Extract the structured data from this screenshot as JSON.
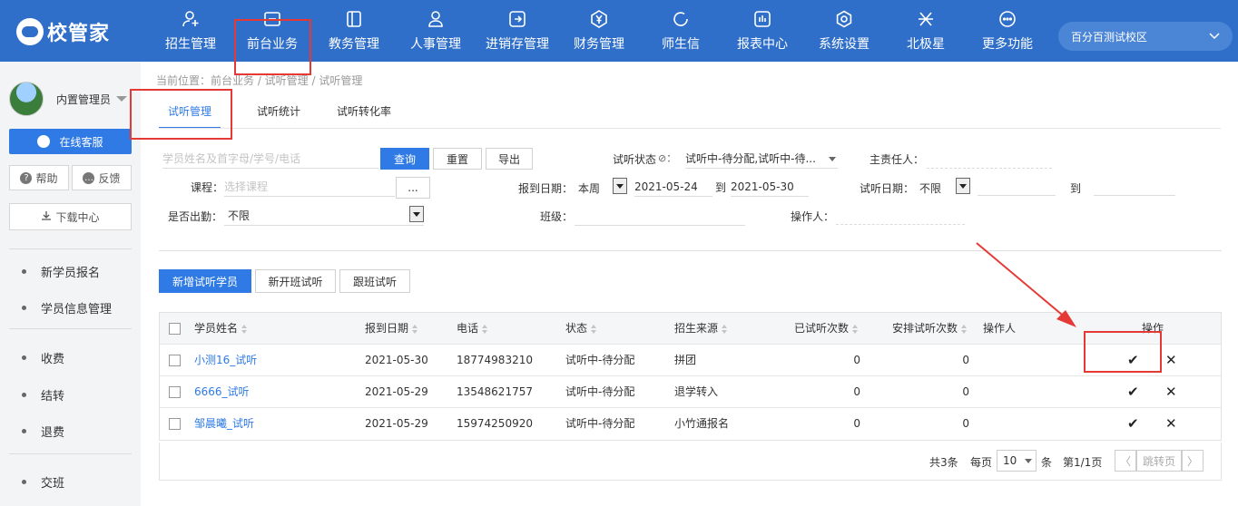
{
  "app": {
    "logo_text": "校管家",
    "campus": "百分百测试校区"
  },
  "nav": [
    {
      "label": "招生管理",
      "icon": "user-add-icon"
    },
    {
      "label": "前台业务",
      "icon": "desk-icon"
    },
    {
      "label": "教务管理",
      "icon": "book-icon"
    },
    {
      "label": "人事管理",
      "icon": "person-icon"
    },
    {
      "label": "进销存管理",
      "icon": "inventory-icon"
    },
    {
      "label": "财务管理",
      "icon": "yen-icon"
    },
    {
      "label": "师生信",
      "icon": "chat-icon"
    },
    {
      "label": "报表中心",
      "icon": "report-icon"
    },
    {
      "label": "系统设置",
      "icon": "settings-icon"
    },
    {
      "label": "北极星",
      "icon": "star-icon"
    },
    {
      "label": "更多功能",
      "icon": "more-icon"
    }
  ],
  "sidebar": {
    "user_name": "内置管理员",
    "customer_service": "在线客服",
    "help": "帮助",
    "feedback": "反馈",
    "download": "下载中心",
    "menu": [
      "新学员报名",
      "学员信息管理",
      "收费",
      "结转",
      "退费",
      "交班"
    ]
  },
  "breadcrumb": "当前位置：前台业务 / 试听管理 / 试听管理",
  "tabs": [
    "试听管理",
    "试听统计",
    "试听转化率"
  ],
  "filters": {
    "search_placeholder": "学员姓名及首字母/学号/电话",
    "query_btn": "查询",
    "reset_btn": "重置",
    "export_btn": "导出",
    "status_label": "试听状态",
    "status_value": "试听中-待分配,试听中-待...",
    "owner_label": "主责任人：",
    "course_label": "课程：",
    "course_placeholder": "选择课程",
    "more_btn": "...",
    "report_date_label": "报到日期：",
    "report_date_mode": "本周",
    "date_from": "2021-05-24",
    "to_text": "到",
    "date_to": "2021-05-30",
    "trial_date_label": "试听日期：",
    "trial_date_mode": "不限",
    "attend_label": "是否出勤：",
    "attend_value": "不限",
    "class_label": "班级：",
    "operator_label": "操作人："
  },
  "actions": {
    "add": "新增试听学员",
    "new_class": "新开班试听",
    "follow_class": "跟班试听"
  },
  "table": {
    "headers": {
      "name": "学员姓名",
      "report_date": "报到日期",
      "phone": "电话",
      "status": "状态",
      "source": "招生来源",
      "done": "已试听次数",
      "arranged": "安排试听次数",
      "operator": "操作人",
      "ops": "操作"
    },
    "rows": [
      {
        "name": "小测16_试听",
        "report_date": "2021-05-30",
        "phone": "18774983210",
        "status": "试听中-待分配",
        "source": "拼团",
        "done": "0",
        "arranged": "0"
      },
      {
        "name": "6666_试听",
        "report_date": "2021-05-29",
        "phone": "13548621757",
        "status": "试听中-待分配",
        "source": "退学转入",
        "done": "0",
        "arranged": "0"
      },
      {
        "name": "邹晨曦_试听",
        "report_date": "2021-05-29",
        "phone": "15974250920",
        "status": "试听中-待分配",
        "source": "小竹通报名",
        "done": "0",
        "arranged": "0"
      }
    ],
    "ok_glyph": "✔",
    "close_glyph": "✕"
  },
  "pager": {
    "total": "共3条",
    "per_page": "每页",
    "page_size": "10",
    "unit": "条",
    "page_info": "第1/1页",
    "prev": "〈",
    "jump": "跳转页",
    "next": "〉"
  },
  "colors": {
    "primary": "#2f7ae5",
    "topbar": "#2f6fc9",
    "annotation": "#e53935"
  }
}
